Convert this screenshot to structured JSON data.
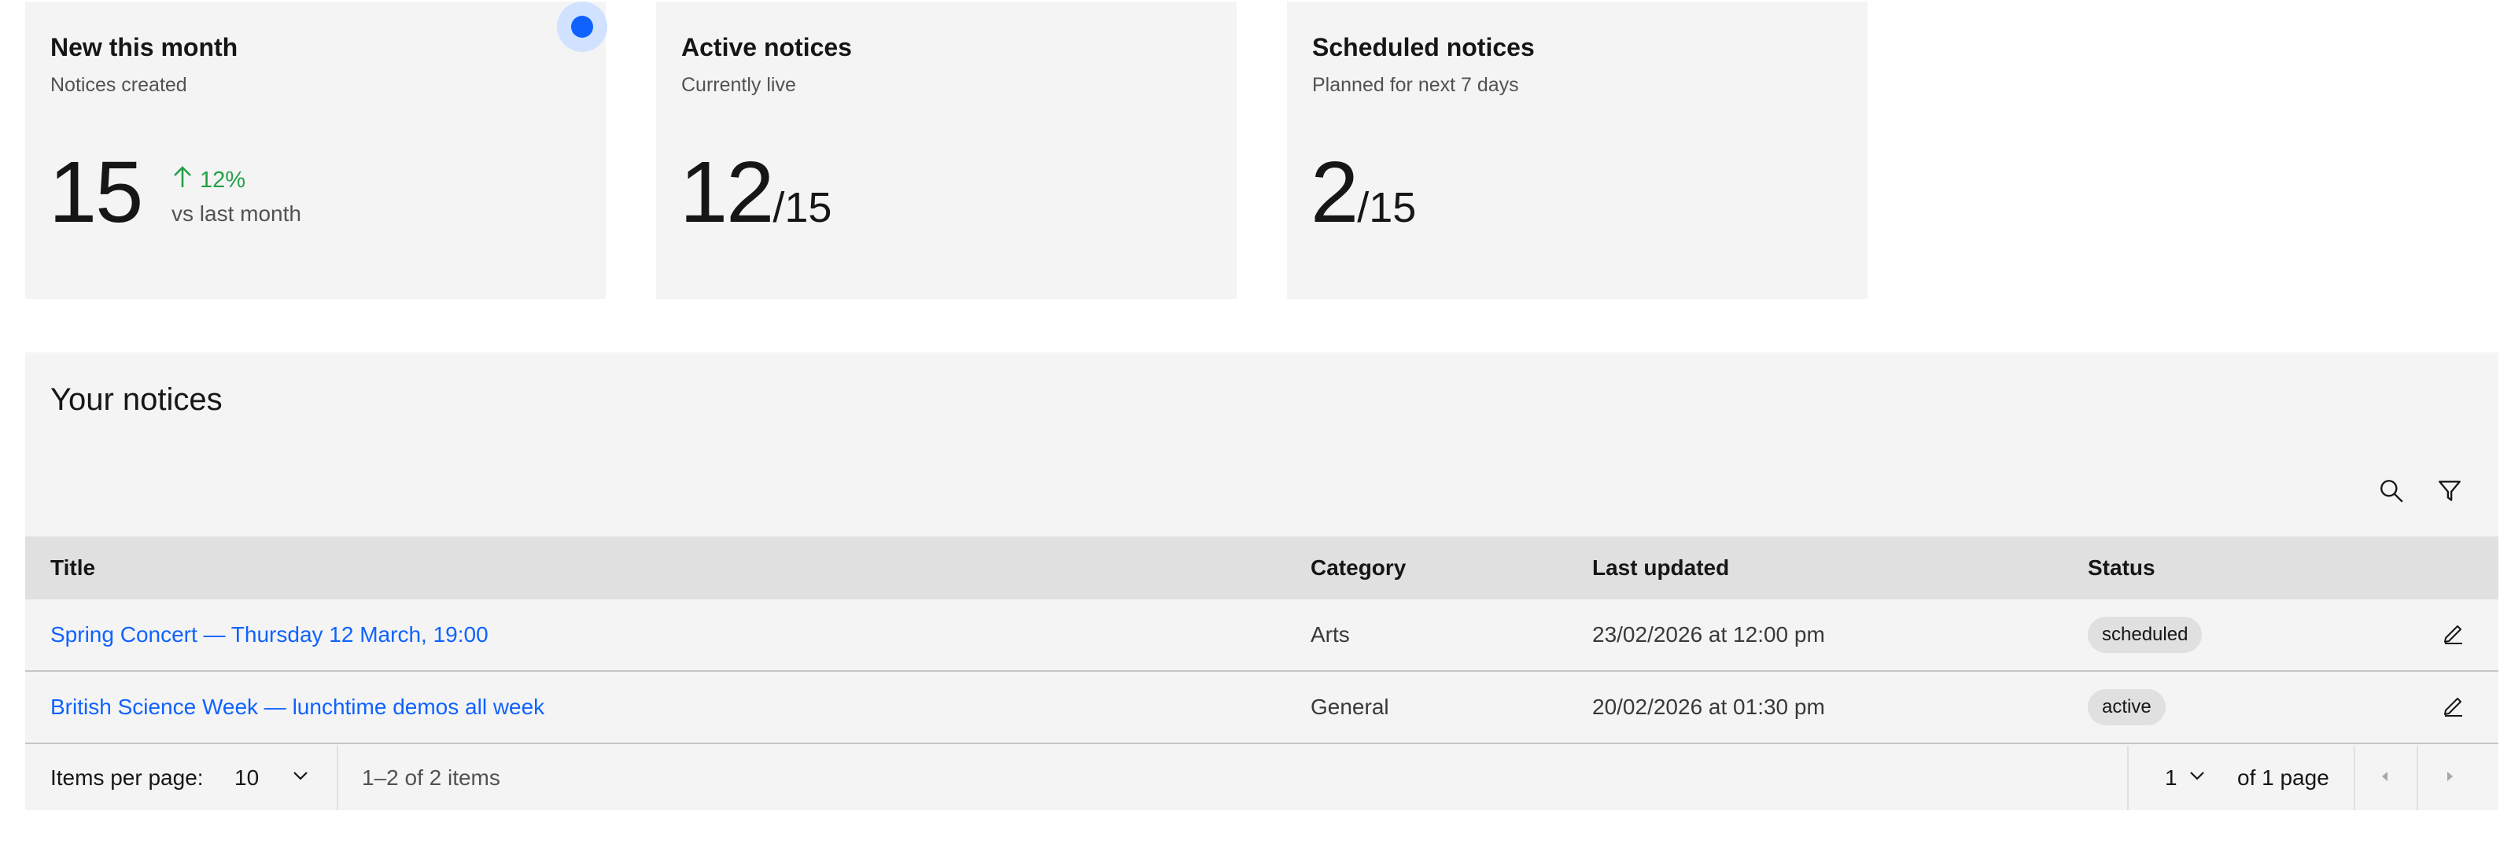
{
  "tiles": [
    {
      "title": "New this month",
      "subtitle": "Notices created",
      "value": "15",
      "trend_value": "12%",
      "trend_direction": "up",
      "trend_caption": "vs last month",
      "selected": true
    },
    {
      "title": "Active notices",
      "subtitle": "Currently live",
      "value": "12",
      "denominator": "/15"
    },
    {
      "title": "Scheduled notices",
      "subtitle": "Planned for next 7 days",
      "value": "2",
      "denominator": "/15"
    }
  ],
  "notices": {
    "title": "Your notices",
    "toolbar": {
      "search_icon": "search-icon",
      "filter_icon": "filter-icon"
    },
    "columns": {
      "title": "Title",
      "category": "Category",
      "last_updated": "Last updated",
      "status": "Status"
    },
    "rows": [
      {
        "title": "Spring Concert — Thursday 12 March, 19:00",
        "category": "Arts",
        "last_updated": "23/02/2026 at 12:00 pm",
        "status": "scheduled"
      },
      {
        "title": "British Science Week — lunchtime demos all week",
        "category": "General",
        "last_updated": "20/02/2026 at 01:30 pm",
        "status": "active"
      }
    ],
    "pagination": {
      "items_per_page_label": "Items per page:",
      "items_per_page": "10",
      "range_text": "1–2 of 2 items",
      "current_page": "1",
      "of_pages": "of 1 page"
    }
  },
  "colors": {
    "accent": "#0f62fe",
    "trend_up": "#24a148",
    "tile_bg": "#f4f4f4",
    "header_bg": "#e0e0e0"
  }
}
